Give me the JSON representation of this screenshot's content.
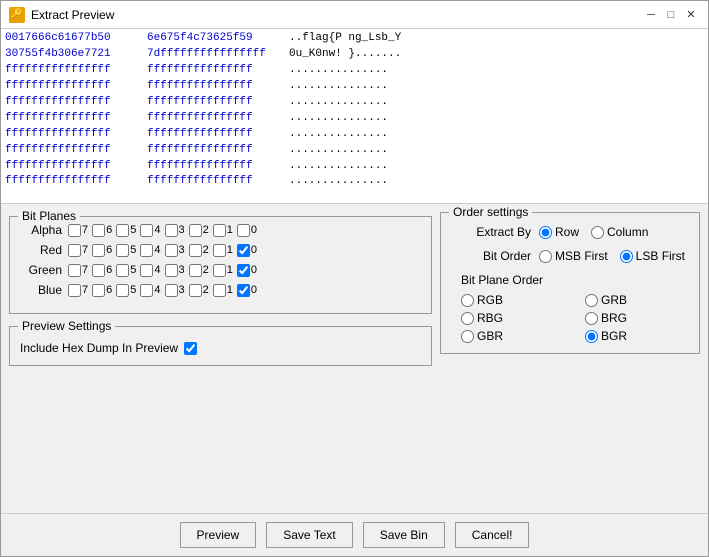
{
  "window": {
    "title": "Extract Preview",
    "icon": "🔑",
    "min_btn": "─",
    "max_btn": "□",
    "close_btn": "✕"
  },
  "hex_lines": [
    {
      "addr": "0017666c61677b50",
      "bytes": "6e675f4c73625f59",
      "ascii": "..flag{P ng_Lsb_Y"
    },
    {
      "addr": "30755f4b306e7721",
      "bytes": "7dffffffffffffffff",
      "ascii": "0u_K0nw! }......."
    },
    {
      "addr": "ffffffffffffffff",
      "bytes": "ffffffffffffffff",
      "ascii": "..............."
    },
    {
      "addr": "ffffffffffffffff",
      "bytes": "ffffffffffffffff",
      "ascii": "..............."
    },
    {
      "addr": "ffffffffffffffff",
      "bytes": "ffffffffffffffff",
      "ascii": "..............."
    },
    {
      "addr": "ffffffffffffffff",
      "bytes": "ffffffffffffffff",
      "ascii": "..............."
    },
    {
      "addr": "ffffffffffffffff",
      "bytes": "ffffffffffffffff",
      "ascii": "..............."
    },
    {
      "addr": "ffffffffffffffff",
      "bytes": "ffffffffffffffff",
      "ascii": "..............."
    },
    {
      "addr": "ffffffffffffffff",
      "bytes": "ffffffffffffffff",
      "ascii": "..............."
    },
    {
      "addr": "ffffffffffffffff",
      "bytes": "ffffffffffffffff",
      "ascii": "..............."
    }
  ],
  "bit_planes": {
    "title": "Bit Planes",
    "rows": [
      {
        "label": "Alpha",
        "bits": [
          7,
          6,
          5,
          4,
          3,
          2,
          1,
          0
        ],
        "checked": []
      },
      {
        "label": "Red",
        "bits": [
          7,
          6,
          5,
          4,
          3,
          2,
          1,
          0
        ],
        "checked": [
          0
        ]
      },
      {
        "label": "Green",
        "bits": [
          7,
          6,
          5,
          4,
          3,
          2,
          1,
          0
        ],
        "checked": [
          0
        ]
      },
      {
        "label": "Blue",
        "bits": [
          7,
          6,
          5,
          4,
          3,
          2,
          1,
          0
        ],
        "checked": [
          0
        ]
      }
    ]
  },
  "preview_settings": {
    "title": "Preview Settings",
    "hex_dump_label": "Include Hex Dump In Preview",
    "hex_dump_checked": true
  },
  "order_settings": {
    "title": "Order settings",
    "extract_by_label": "Extract By",
    "extract_by_options": [
      "Row",
      "Column"
    ],
    "extract_by_selected": "Row",
    "bit_order_label": "Bit Order",
    "bit_order_options": [
      "MSB First",
      "LSB First"
    ],
    "bit_order_selected": "LSB First",
    "bit_plane_order_title": "Bit Plane Order",
    "bit_plane_options": [
      "RGB",
      "GRB",
      "RBG",
      "BRG",
      "GBR",
      "BGR"
    ],
    "bit_plane_selected": "BGR"
  },
  "footer": {
    "preview_btn": "Preview",
    "save_text_btn": "Save Text",
    "save_bin_btn": "Save Bin",
    "cancel_btn": "Cancel!"
  }
}
